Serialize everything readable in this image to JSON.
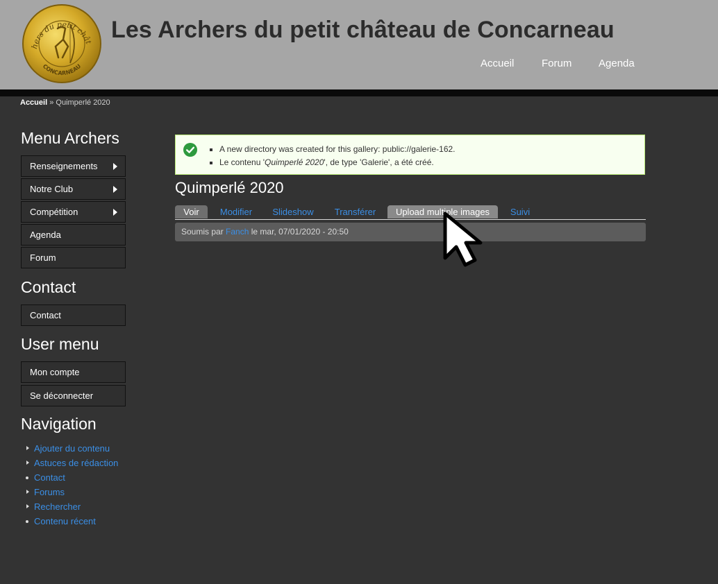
{
  "header": {
    "site_title": "Les Archers du petit château de Concarneau",
    "logo": {
      "icon": "archer-seal-logo",
      "text_top": "Archers du petit château",
      "text_bottom": "CONCARNEAU"
    },
    "nav": [
      "Accueil",
      "Forum",
      "Agenda"
    ]
  },
  "breadcrumb": {
    "home": "Accueil",
    "separator": "»",
    "current": "Quimperlé 2020"
  },
  "sidebar": {
    "menu_archers": {
      "title": "Menu Archers",
      "items": [
        {
          "label": "Renseignements",
          "submenu": true
        },
        {
          "label": "Notre Club",
          "submenu": true
        },
        {
          "label": "Compétition",
          "submenu": true
        },
        {
          "label": "Agenda",
          "submenu": false
        },
        {
          "label": "Forum",
          "submenu": false
        }
      ]
    },
    "contact": {
      "title": "Contact",
      "items": [
        {
          "label": "Contact"
        }
      ]
    },
    "user_menu": {
      "title": "User menu",
      "items": [
        {
          "label": "Mon compte"
        },
        {
          "label": "Se déconnecter"
        }
      ]
    },
    "navigation": {
      "title": "Navigation",
      "items": [
        {
          "label": "Ajouter du contenu",
          "bullet": "triangle"
        },
        {
          "label": "Astuces de rédaction",
          "bullet": "triangle"
        },
        {
          "label": "Contact",
          "bullet": "dot"
        },
        {
          "label": "Forums",
          "bullet": "triangle"
        },
        {
          "label": "Rechercher",
          "bullet": "triangle"
        },
        {
          "label": "Contenu récent",
          "bullet": "dot"
        }
      ]
    }
  },
  "messages": {
    "status_icon": "check-circle-icon",
    "items": [
      {
        "text": "A new directory was created for this gallery: public://galerie-162."
      },
      {
        "prefix": "Le contenu '",
        "emphasis": "Quimperlé 2020",
        "suffix": "', de type 'Galerie', a été créé."
      }
    ]
  },
  "page": {
    "title": "Quimperlé 2020",
    "tabs": [
      {
        "label": "Voir",
        "state": "active"
      },
      {
        "label": "Modifier",
        "state": "normal"
      },
      {
        "label": "Slideshow",
        "state": "normal"
      },
      {
        "label": "Transférer",
        "state": "normal"
      },
      {
        "label": "Upload multiple images",
        "state": "hover"
      },
      {
        "label": "Suivi",
        "state": "normal"
      }
    ],
    "submitted": {
      "prefix": "Soumis par ",
      "author": "Fanch",
      "suffix": " le mar, 07/01/2020 - 20:50"
    }
  },
  "colors": {
    "header_bg": "#a6a6a6",
    "page_bg": "#333333",
    "link": "#3b8fe6",
    "message_bg": "#f8fff0",
    "message_border": "#bbee77",
    "status_green": "#2e9a3e"
  }
}
